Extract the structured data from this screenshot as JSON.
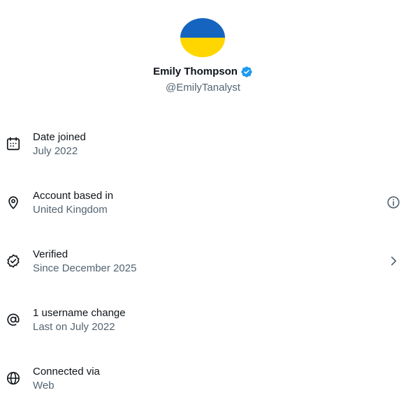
{
  "profile": {
    "name": "Emily Thompson",
    "handle": "@EmilyTanalyst",
    "verified": true,
    "avatar_icon": "ukraine-flag-avatar",
    "avatar_colors": [
      "#1565c0",
      "#ffd600"
    ]
  },
  "items": [
    {
      "label": "Date joined",
      "value": "July 2022",
      "icon": "calendar-icon"
    },
    {
      "label": "Account based in",
      "value": "United Kingdom",
      "icon": "location-pin-icon",
      "trailing_icon": "info-icon"
    },
    {
      "label": "Verified",
      "value": "Since December 2025",
      "icon": "verified-check-icon",
      "trailing_icon": "chevron-right-icon"
    },
    {
      "label": "1 username change",
      "value": "Last on July 2022",
      "icon": "at-sign-icon"
    },
    {
      "label": "Connected via",
      "value": "Web",
      "icon": "globe-icon"
    }
  ],
  "colors": {
    "text_primary": "#0f1419",
    "text_secondary": "#536471",
    "verified_blue": "#1d9bf0"
  }
}
